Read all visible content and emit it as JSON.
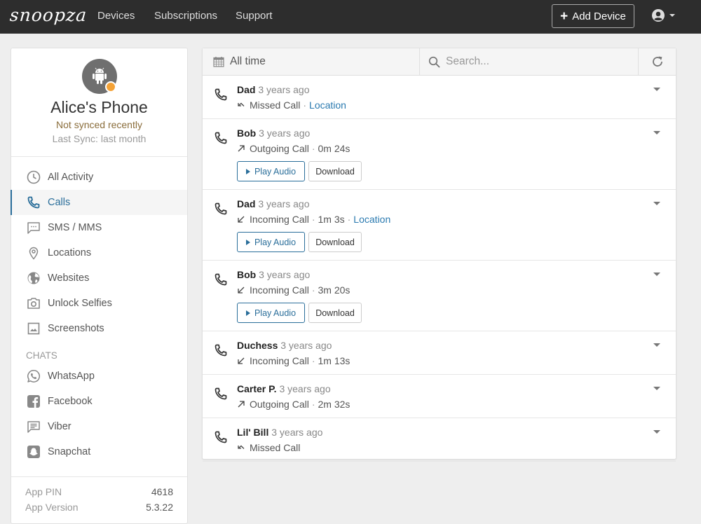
{
  "topbar": {
    "logo": "snoopza",
    "nav": [
      "Devices",
      "Subscriptions",
      "Support"
    ],
    "add_device_label": "Add Device",
    "user_icon": "user-circle-icon"
  },
  "device": {
    "name": "Alice's Phone",
    "sync_status": "Not synced recently",
    "last_sync": "Last Sync: last month",
    "status_color": "#f4a236",
    "icon": "android-icon"
  },
  "sidebar": {
    "items": [
      {
        "label": "All Activity",
        "icon": "clock-icon"
      },
      {
        "label": "Calls",
        "icon": "phone-icon",
        "active": true
      },
      {
        "label": "SMS / MMS",
        "icon": "chat-bubble-icon"
      },
      {
        "label": "Locations",
        "icon": "map-pin-icon"
      },
      {
        "label": "Websites",
        "icon": "globe-icon"
      },
      {
        "label": "Unlock Selfies",
        "icon": "camera-icon"
      },
      {
        "label": "Screenshots",
        "icon": "image-icon"
      }
    ],
    "chats_label": "CHATS",
    "chats": [
      {
        "label": "WhatsApp",
        "icon": "whatsapp-icon"
      },
      {
        "label": "Facebook",
        "icon": "facebook-icon"
      },
      {
        "label": "Viber",
        "icon": "message-icon"
      },
      {
        "label": "Snapchat",
        "icon": "snapchat-icon"
      }
    ],
    "footer": {
      "app_pin_label": "App PIN",
      "app_pin": "4618",
      "app_version_label": "App Version",
      "app_version": "5.3.22"
    }
  },
  "toolbar": {
    "date_filter": "All time",
    "search_placeholder": "Search...",
    "search_value": ""
  },
  "buttons": {
    "play_audio": "Play Audio",
    "download": "Download",
    "location": "Location"
  },
  "calls": [
    {
      "name": "Dad",
      "time": "3 years ago",
      "type": "missed",
      "label": "Missed Call",
      "duration": "",
      "location": true,
      "audio": false
    },
    {
      "name": "Bob",
      "time": "3 years ago",
      "type": "outgoing",
      "label": "Outgoing Call",
      "duration": "0m 24s",
      "location": false,
      "audio": true
    },
    {
      "name": "Dad",
      "time": "3 years ago",
      "type": "incoming",
      "label": "Incoming Call",
      "duration": "1m 3s",
      "location": true,
      "audio": true
    },
    {
      "name": "Bob",
      "time": "3 years ago",
      "type": "incoming",
      "label": "Incoming Call",
      "duration": "3m 20s",
      "location": false,
      "audio": true
    },
    {
      "name": "Duchess",
      "time": "3 years ago",
      "type": "incoming",
      "label": "Incoming Call",
      "duration": "1m 13s",
      "location": false,
      "audio": false
    },
    {
      "name": "Carter P.",
      "time": "3 years ago",
      "type": "outgoing",
      "label": "Outgoing Call",
      "duration": "2m 32s",
      "location": false,
      "audio": false
    },
    {
      "name": "Lil' Bill",
      "time": "3 years ago",
      "type": "missed",
      "label": "Missed Call",
      "duration": "",
      "location": false,
      "audio": false
    }
  ],
  "colors": {
    "accent": "#2a6e9a",
    "link": "#2a7ab0",
    "topbar": "#2d2d2d",
    "warning_text": "#8a6d3b"
  }
}
